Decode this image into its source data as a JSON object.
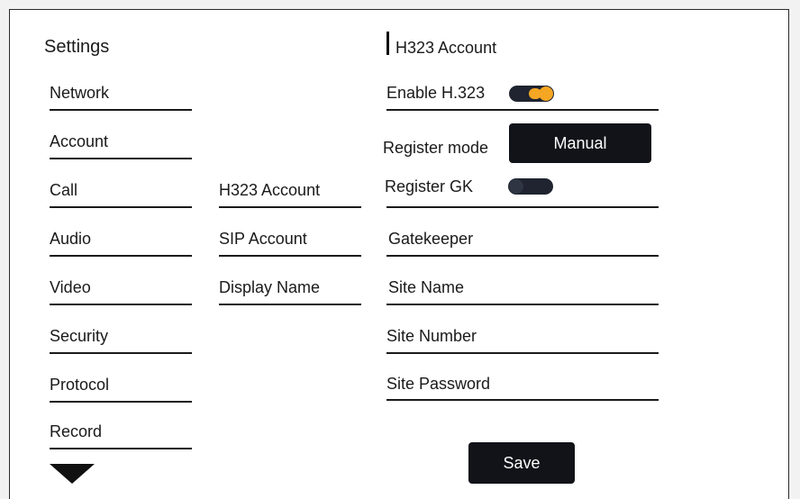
{
  "sidebar": {
    "title": "Settings",
    "items": [
      {
        "label": "Network"
      },
      {
        "label": "Account"
      },
      {
        "label": "Call"
      },
      {
        "label": "Audio"
      },
      {
        "label": "Video"
      },
      {
        "label": "Security"
      },
      {
        "label": "Protocol"
      },
      {
        "label": "Record"
      }
    ],
    "more_icon": "triangle-down-icon"
  },
  "submenu": {
    "items": [
      {
        "label": "H323 Account"
      },
      {
        "label": "SIP Account"
      },
      {
        "label": "Display Name"
      }
    ]
  },
  "form": {
    "title": "H323 Account",
    "enable_h323": {
      "label": "Enable H.323",
      "state": "on"
    },
    "register_mode": {
      "label": "Register mode",
      "value": "Manual"
    },
    "register_gk": {
      "label": "Register GK",
      "state": "off"
    },
    "fields": [
      {
        "label": "Gatekeeper"
      },
      {
        "label": "Site Name"
      },
      {
        "label": "Site Number"
      },
      {
        "label": "Site Password"
      }
    ],
    "save_label": "Save"
  },
  "colors": {
    "accent": "#f5a623",
    "dark": "#1f2430",
    "button_bg": "#111318"
  }
}
